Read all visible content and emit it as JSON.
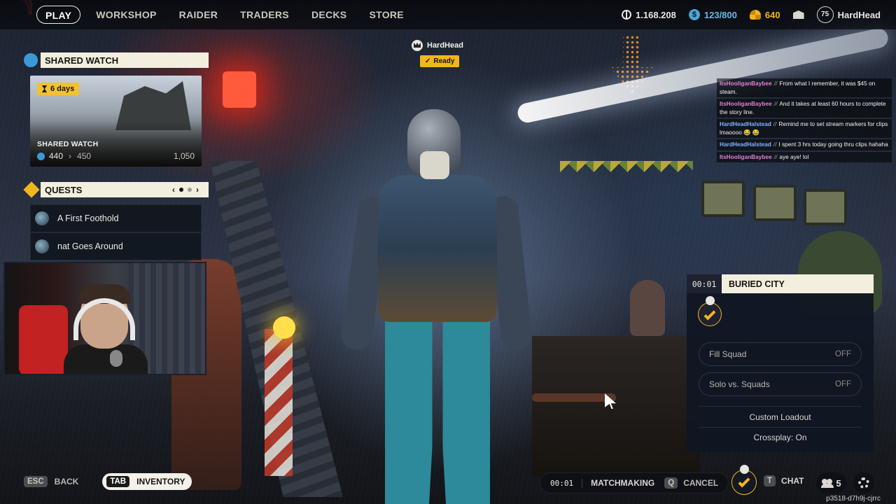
{
  "nav": {
    "items": [
      {
        "label": "PLAY",
        "active": true
      },
      {
        "label": "WORKSHOP",
        "active": false
      },
      {
        "label": "RAIDER",
        "active": false
      },
      {
        "label": "TRADERS",
        "active": false
      },
      {
        "label": "DECKS",
        "active": false
      },
      {
        "label": "STORE",
        "active": false
      }
    ]
  },
  "currencies": {
    "coins": "1.168.208",
    "credits": "123/800",
    "tokens": "640"
  },
  "profile": {
    "level": "75",
    "name": "HardHead"
  },
  "player_tag": {
    "name": "HardHead",
    "status": "Ready"
  },
  "shared_watch": {
    "header": "SHARED WATCH",
    "days": "6 days",
    "card_title": "SHARED WATCH",
    "current": "440",
    "next": "450",
    "max": "1,050"
  },
  "quests": {
    "header": "QUESTS",
    "page": 1,
    "pages": 2,
    "items": [
      {
        "title": "A First Foothold"
      },
      {
        "title": "nat Goes Around"
      }
    ]
  },
  "chat": {
    "messages": [
      {
        "user": "ItsHooliganBaybee",
        "text": "From what I remember, it was $45 on steam."
      },
      {
        "user": "ItsHooliganBaybee",
        "text": "And it takes at least 60 hours to complete the story line."
      },
      {
        "user": "HardHeadHalstead",
        "text": "Remind me to set stream markers for clips lmaoooo 😂 😂"
      },
      {
        "user": "HardHeadHalstead",
        "text": "I spent 3 hrs today going thru clips hahaha"
      },
      {
        "user": "ItsHooliganBaybee",
        "text": "aye aye! lol"
      }
    ]
  },
  "match": {
    "timer": "00:01",
    "map": "BURIED CITY",
    "fill_squad": {
      "label": "Fill Squad",
      "value": "OFF"
    },
    "solo_vs_squads": {
      "label": "Solo vs. Squads",
      "value": "OFF"
    },
    "custom_loadout": "Custom Loadout",
    "crossplay": "Crossplay: On"
  },
  "bottom": {
    "back_key": "ESC",
    "back_label": "BACK",
    "inventory_key": "TAB",
    "inventory_label": "INVENTORY",
    "mm_timer": "00:01",
    "mm_label": "MATCHMAKING",
    "cancel_key": "Q",
    "cancel_label": "CANCEL",
    "chat_key": "T",
    "chat_label": "CHAT",
    "party_count": "5",
    "build_id": "p3518-d7h9j-cjrrc"
  },
  "colors": {
    "accent": "#f1b61d",
    "panel_header": "#f3efdf",
    "blue_badge": "#3b9ad6",
    "chat_user_pink": "#e67fd5",
    "chat_user_blue": "#7fb4ff"
  }
}
